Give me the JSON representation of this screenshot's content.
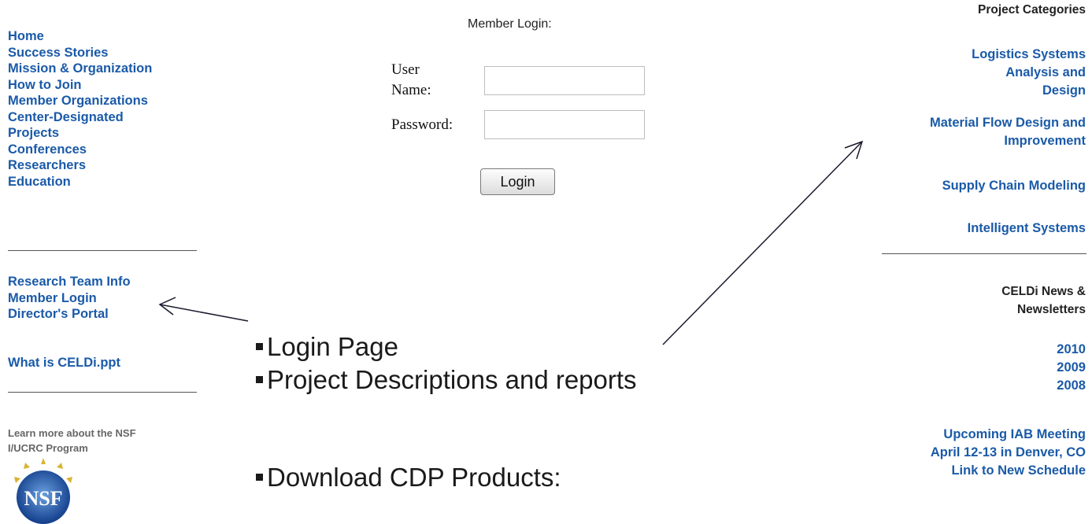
{
  "left_nav": {
    "primary": [
      "Home",
      "Success Stories",
      "Mission & Organization",
      "How to Join",
      "Member Organizations",
      "Center-Designated Projects",
      "Conferences",
      "Researchers",
      "Education"
    ],
    "secondary": [
      "Research Team Info",
      "Member Login",
      "Director's Portal"
    ],
    "ppt_link": "What is CELDi.ppt",
    "learn_more": "Learn more about the NSF I/UCRC Program"
  },
  "login": {
    "heading": "Member Login:",
    "username_label": "User Name:",
    "password_label": "Password:",
    "username_value": "",
    "password_value": "",
    "button_label": "Login"
  },
  "right_col": {
    "categories_heading": "Project Categories",
    "categories": [
      "Logistics Systems Analysis and Design",
      "Material Flow Design and Improvement",
      "Supply Chain Modeling",
      "Intelligent Systems"
    ],
    "news_heading": "CELDi News & Newsletters",
    "years": [
      "2010",
      "2009",
      "2008"
    ],
    "meeting_line1": "Upcoming IAB Meeting",
    "meeting_line2": "April 12-13 in Denver, CO",
    "meeting_link": "Link to New Schedule"
  },
  "bullets": [
    "Login Page",
    "Project Descriptions and reports",
    "Download CDP Products:"
  ],
  "logo": {
    "text": "NSF",
    "icon": "nsf-logo-icon"
  },
  "colors": {
    "link": "#1a5aa8",
    "text": "#1a1a1a"
  }
}
